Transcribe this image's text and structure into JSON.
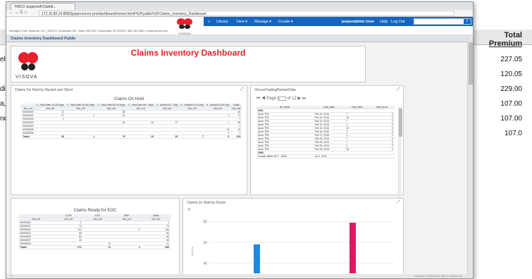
{
  "background_report": {
    "header": {
      "line1": "Total",
      "line2": "Premium"
    },
    "rows": [
      {
        "label": "el, B",
        "value": "227.05"
      },
      {
        "label": "",
        "value": "120.05"
      },
      {
        "label": "dini,",
        "value": "229.00"
      },
      {
        "label": "a, Jo",
        "value": "107.00"
      },
      {
        "label": "ne, I",
        "value": "107.00"
      },
      {
        "label": "",
        "value": "107.0"
      }
    ]
  },
  "browser": {
    "tab_title": "TIBCO Jaspersoft Dashb...",
    "url": "172.16.80.24:8080/jasperserver-pro/dashboard/viewer.html#%2Fpublic%2FClaims_Inventory_Dashboard"
  },
  "app": {
    "company_line": "Managed Care Systems, Inc.  |  9333 N. Scottsdale Rd., Suite 183-224  |  Scottsdale, AZ 85253  |  480-434-3681  |  www.visova.com",
    "logo_word": "VISOVA",
    "nav": {
      "library": "Library",
      "view": "View ▾",
      "manage": "Manage ▾",
      "create": "Create ▾",
      "user": "jasperadmin User",
      "help": "Help",
      "logout": "Log Out"
    },
    "dashboard_name": "Claims Inventory Dashboard Public"
  },
  "dashboard": {
    "title": "Claims Inventory Dashboard",
    "logo_word": "VISOVA",
    "panel_hold_bucket": {
      "title": "Claims On Hold by Bucket and Client",
      "table_title": "Claims On Hold",
      "group_headers": [
        "0 - Paid Date 15-30 Days",
        "1 - Paid Date 30-60 Days",
        "2 - Paid Date 60-90 Days",
        "3 - Paid Date 90+ Days",
        "4 - Submit Dt 7 Day",
        "5 - Submit Dt 14 Day",
        "6 - Submit Dt 30 Day",
        "Totals"
      ],
      "row_header": "clm_cnt",
      "sub_header": "clm_cnt",
      "rows": [
        {
          "id": "00000000",
          "v": [
            "12",
            "",
            "28",
            "",
            "",
            "",
            "",
            "40"
          ]
        },
        {
          "id": "00000001",
          "v": [
            "37",
            "1",
            "32",
            "",
            "",
            "",
            "1",
            "71"
          ]
        },
        {
          "id": "00000002",
          "v": [
            "1",
            "",
            "",
            "",
            "",
            "",
            "",
            "1"
          ]
        },
        {
          "id": "00000003",
          "v": [
            "",
            "",
            "21",
            "16",
            "27",
            "",
            "1",
            "65"
          ]
        },
        {
          "id": "00000004",
          "v": [
            "",
            "",
            "",
            "",
            "",
            "",
            "",
            "1"
          ]
        },
        {
          "id": "00000005",
          "v": [
            "",
            "",
            "",
            "",
            "",
            "",
            "13",
            "13"
          ]
        },
        {
          "id": "00000006",
          "v": [
            "",
            "",
            "",
            "",
            "",
            "",
            "1",
            "1"
          ]
        }
      ],
      "totals": {
        "label": "Totals",
        "v": [
          "35",
          "1",
          "79",
          "16",
          "30",
          "7",
          "8",
          "205"
        ]
      }
    },
    "panel_trading_partner": {
      "title": "VisovaTradingPartnerData",
      "pager": {
        "first": "⏮",
        "prev": "◀",
        "label": "Page",
        "value": "1",
        "of": "of 12",
        "next": "▶",
        "last": "⏭"
      },
      "columns": [
        "tbl_name",
        "load_date",
        "load_total",
        "load_error"
      ],
      "group1": "ARA",
      "rows": [
        {
          "name": "Anne TPA",
          "date": "Feb 10, 2016",
          "total": "7",
          "err": "0"
        },
        {
          "name": "Anne TPA",
          "date": "Feb 10, 2016",
          "total": "19",
          "err": "0"
        },
        {
          "name": "Anne TPA",
          "date": "Feb 10, 2016",
          "total": "7",
          "err": "0"
        },
        {
          "name": "Anne TPA",
          "date": "Feb 10, 2016",
          "total": "1",
          "err": "0"
        },
        {
          "name": "Anne TPA",
          "date": "Feb 10, 2016",
          "total": "13",
          "err": "0"
        },
        {
          "name": "Anne TPA",
          "date": "Feb 16, 2016",
          "total": "1",
          "err": "0"
        },
        {
          "name": "Anne TPA",
          "date": "Feb 17, 2016",
          "total": "1",
          "err": "0"
        },
        {
          "name": "Anne TPA",
          "date": "Feb 24, 2016",
          "total": "7",
          "err": "0"
        },
        {
          "name": "Anne TPA",
          "date": "Feb 29, 2016",
          "total": "7",
          "err": "0"
        },
        {
          "name": "Anne TPA",
          "date": "Feb 29, 2016",
          "total": "1",
          "err": "0"
        },
        {
          "name": "Anne TPA",
          "date": "Feb 29, 2016",
          "total": "10",
          "err": "0"
        }
      ],
      "group2": "GRB",
      "last_row": {
        "name": "Gunder Mifflin SCT - 4/5/6",
        "date": "Jul 9, 2015",
        "total": "",
        "err": ""
      }
    },
    "panel_ready_eoc": {
      "table_title": "Claims Ready for EOC",
      "col_groups": [
        "0-100",
        "100+",
        "365+",
        "Totals"
      ],
      "row_header": "clm_cnt",
      "sub_header": "clm_cnt",
      "rows": [
        {
          "id": "00000000",
          "v": [
            "1",
            "",
            "",
            "1"
          ]
        },
        {
          "id": "00000001",
          "v": [
            "70",
            "",
            "",
            "70"
          ]
        },
        {
          "id": "00000002",
          "v": [
            "112",
            "",
            "4",
            "116"
          ]
        },
        {
          "id": "00000003",
          "v": [
            "66",
            "",
            "",
            "66"
          ]
        },
        {
          "id": "00000004",
          "v": [
            "63",
            "",
            "",
            "63"
          ]
        },
        {
          "id": "00000007",
          "v": [
            "40",
            "",
            "",
            "40"
          ]
        },
        {
          "id": "00000009",
          "v": [
            "",
            "11",
            "",
            "11"
          ]
        }
      ],
      "totals": {
        "label": "Totals",
        "v": [
          "271",
          "11",
          "4",
          "286"
        ]
      }
    },
    "panel_hold_route": {
      "title": "Claims on Hold by Route",
      "ylabel": "clm_cnt",
      "footer_left": "Fi",
      "footer_right": "Copyright © 2005-2015 TIBCO Software Inc."
    }
  },
  "colors": {
    "nav_blue": "#1565c0",
    "title_red": "#e8202a",
    "bar_blue": "#1e88e5",
    "bar_magenta": "#d81b60"
  },
  "chart_data": {
    "type": "bar",
    "title": "Claims on Hold by Route",
    "ylabel": "clm_cnt",
    "yticks": [
      40,
      60,
      80
    ],
    "ylim": [
      30,
      90
    ],
    "series": [
      {
        "values": [
          58
        ]
      },
      {
        "values": [
          79
        ]
      }
    ]
  }
}
